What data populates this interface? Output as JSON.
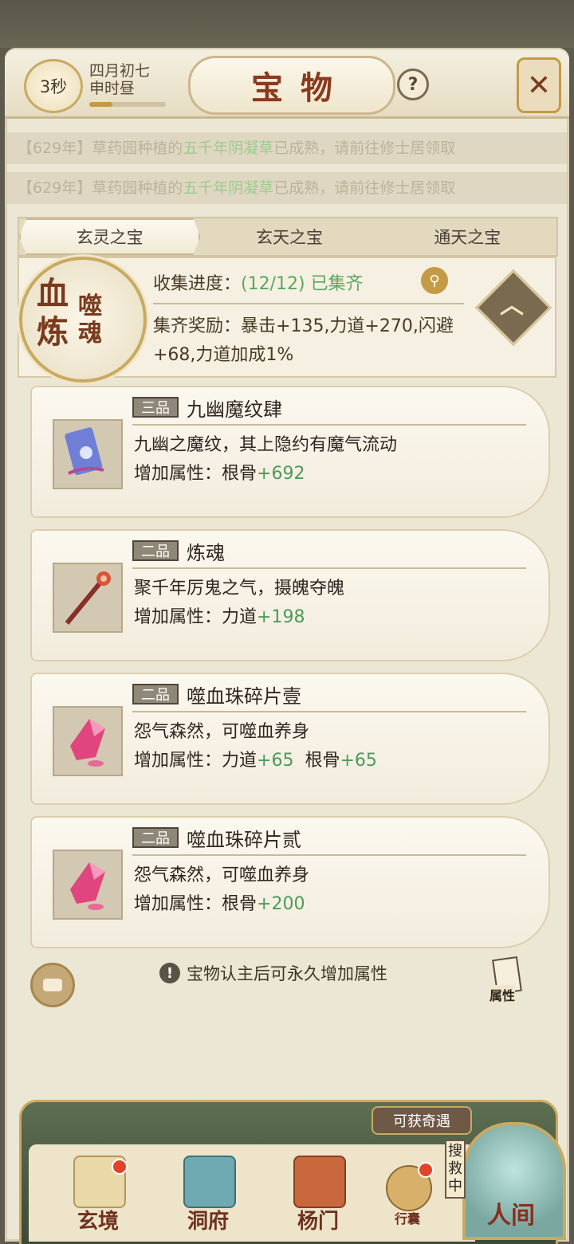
{
  "header": {
    "timer": "3秒",
    "date_line1": "四月初七",
    "date_line2": "申时昼",
    "title": "宝物",
    "help": "?"
  },
  "notices": [
    {
      "prefix": "【629年】草药园种植的",
      "highlight": "五千年阴凝草",
      "suffix": "已成熟，请前往修士居领取"
    },
    {
      "prefix": "【629年】草药园种植的",
      "highlight": "五千年阴凝草",
      "suffix": "已成熟，请前往修士居领取"
    }
  ],
  "tabs": [
    {
      "label": "玄灵之宝",
      "active": true
    },
    {
      "label": "玄天之宝",
      "active": false
    },
    {
      "label": "通天之宝",
      "active": false
    }
  ],
  "collection": {
    "seal": {
      "char1": "血",
      "char2": "炼",
      "char3": "噬魂"
    },
    "progress_label": "收集进度：",
    "progress_value": "(12/12) 已集齐",
    "reward_label": "集齐奖励：",
    "reward_text": "暴击+135,力道+270,闪避+68,力道加成1%"
  },
  "items": [
    {
      "grade": "三品",
      "name": "九幽魔纹肆",
      "desc": "九幽之魔纹，其上隐约有魔气流动",
      "attr_label": "增加属性：",
      "stats": [
        {
          "name": "根骨",
          "value": "+692"
        }
      ],
      "icon": "scroll-icon",
      "color": "#6f7fd6"
    },
    {
      "grade": "二品",
      "name": "炼魂",
      "desc": "聚千年厉鬼之气，摄魄夺魄",
      "attr_label": "增加属性：",
      "stats": [
        {
          "name": "力道",
          "value": "+198"
        }
      ],
      "icon": "staff-icon",
      "color": "#8a2e2a"
    },
    {
      "grade": "二品",
      "name": "噬血珠碎片壹",
      "desc": "怨气森然，可噬血养身",
      "attr_label": "增加属性：",
      "stats": [
        {
          "name": "力道",
          "value": "+65"
        },
        {
          "name": "根骨",
          "value": "+65"
        }
      ],
      "icon": "crystal-icon",
      "color": "#e0457e"
    },
    {
      "grade": "二品",
      "name": "噬血珠碎片贰",
      "desc": "怨气森然，可噬血养身",
      "attr_label": "增加属性：",
      "stats": [
        {
          "name": "根骨",
          "value": "+200"
        }
      ],
      "icon": "crystal-icon",
      "color": "#e0457e"
    }
  ],
  "tip": "宝物认主后可永久增加属性",
  "attr_button": "属性",
  "bottom_nav": {
    "items": [
      {
        "label": "玄境",
        "icon": "scroll-map-icon",
        "badge": true
      },
      {
        "label": "洞府",
        "icon": "pavilion-icon",
        "badge": false
      },
      {
        "label": "杨门",
        "icon": "banner-icon",
        "badge": false
      },
      {
        "label": "行囊",
        "icon": "pouch-icon",
        "badge": true
      }
    ],
    "encounter": "可获奇遇",
    "search_tag": "搜救中",
    "world": "人间"
  }
}
